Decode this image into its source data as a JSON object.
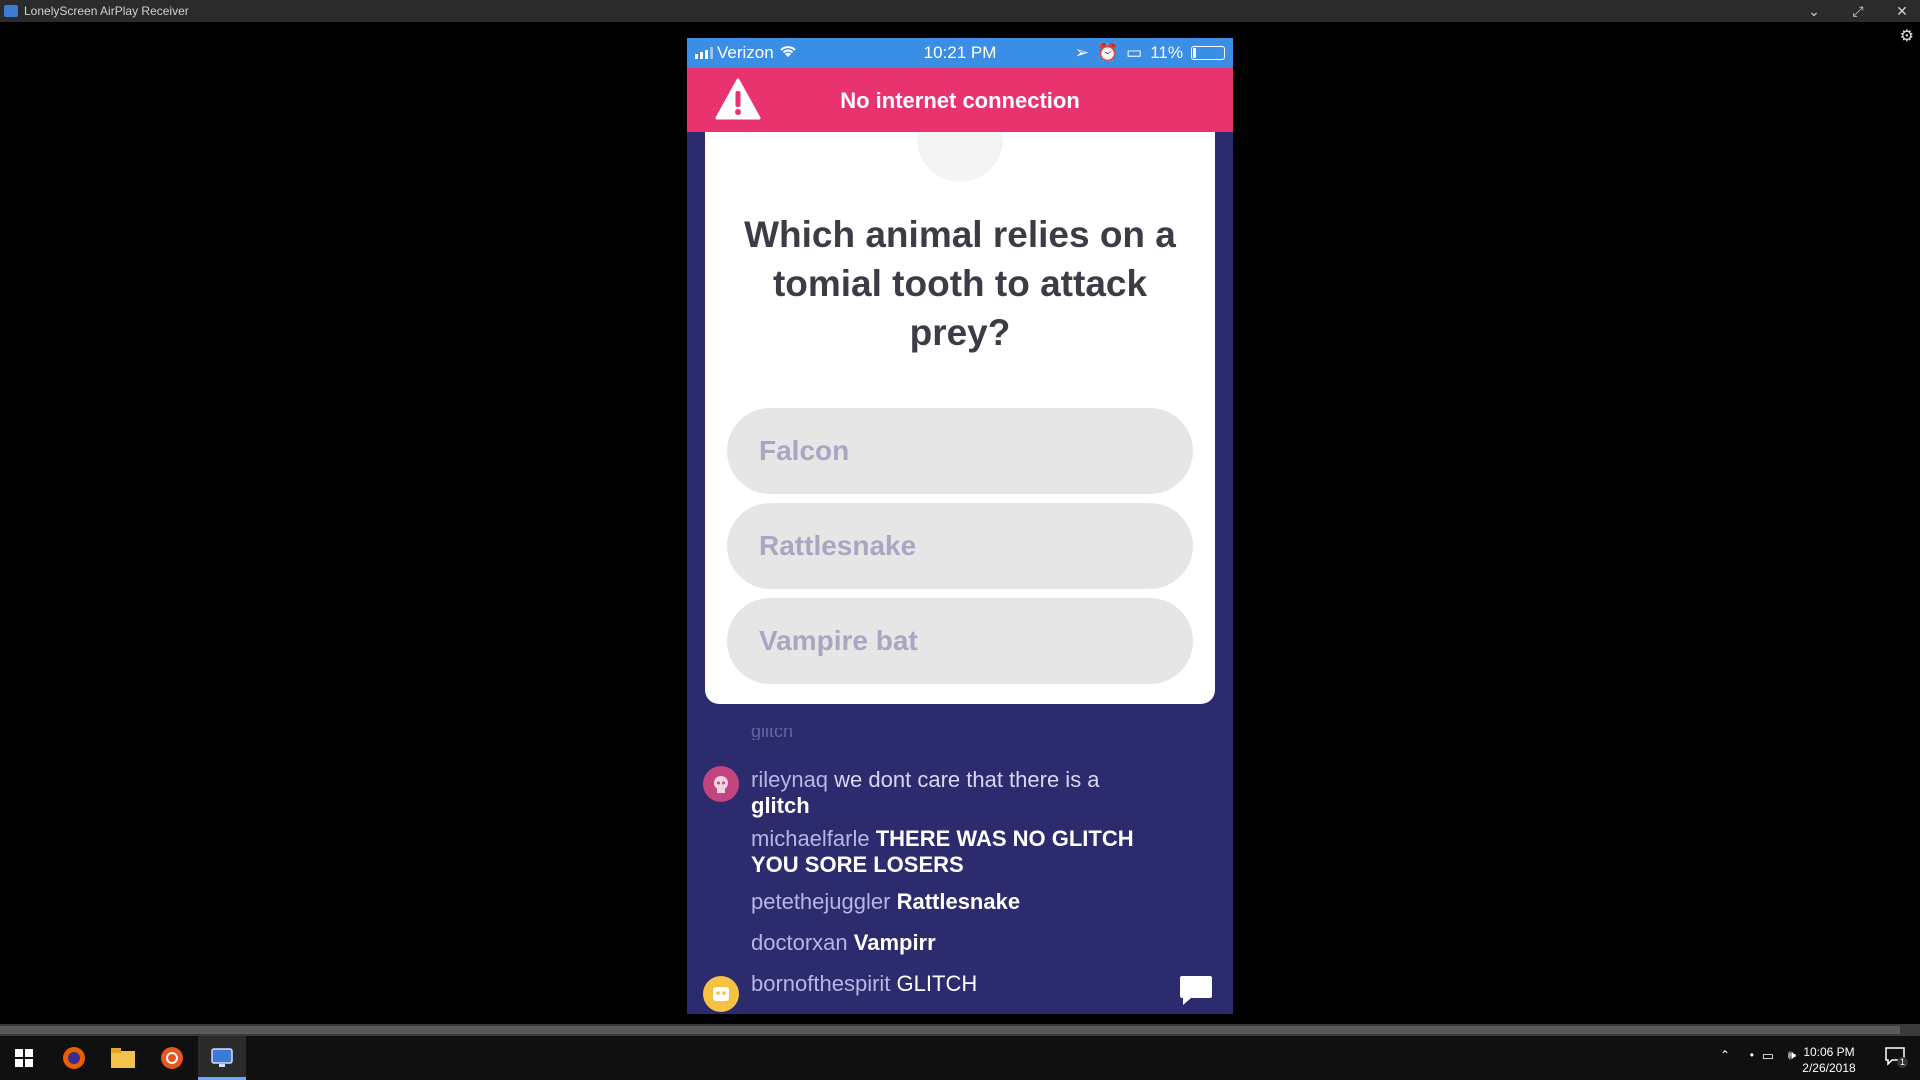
{
  "window": {
    "title": "LonelyScreen AirPlay Receiver",
    "controls": [
      "chevron-down",
      "maximize",
      "close"
    ]
  },
  "status_bar": {
    "carrier": "Verizon",
    "time": "10:21 PM",
    "battery": "11%",
    "battery_level": 0.11
  },
  "alert": {
    "message": "No internet connection",
    "color": "#e8336e"
  },
  "quiz": {
    "question": "Which animal relies on a tomial tooth to attack prey?",
    "answers": [
      "Falcon",
      "Rattlesnake",
      "Vampire bat"
    ]
  },
  "chat": {
    "cut_off_text": "glitch",
    "messages": [
      {
        "user": "rileynaq",
        "text": "we dont care that there is a",
        "text2": "glitch"
      },
      {
        "user": "michaelfarle",
        "text": "THERE WAS NO GLITCH",
        "text2": "YOU SORE LOSERS"
      },
      {
        "user": "petethejuggler",
        "text": "Rattlesnake"
      },
      {
        "user": "doctorxan",
        "text": "Vampirr"
      },
      {
        "user": "bornofthespirit",
        "text": "GLITCH"
      }
    ]
  },
  "taskbar": {
    "apps": [
      "windows-start",
      "firefox",
      "file-explorer",
      "ubuntu",
      "lonelyscreen"
    ],
    "time": "10:06 PM",
    "date": "2/26/2018",
    "notification_count": "1"
  },
  "colors": {
    "status_bar": "#3a8ee6",
    "background": "#2b2b6e",
    "answer_bg": "#e6e6e6"
  }
}
